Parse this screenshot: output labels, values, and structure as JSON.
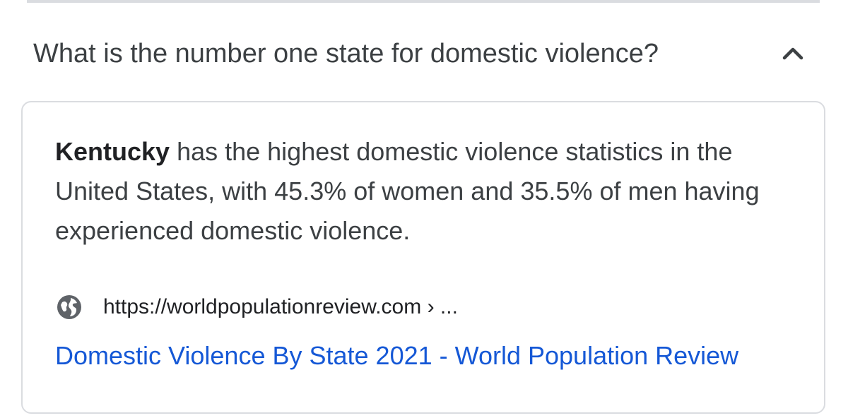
{
  "question": {
    "text": "What is the number one state for domestic violence?",
    "toggle_icon": "chevron-up-icon"
  },
  "answer": {
    "highlight": "Kentucky",
    "body": " has the highest domestic violence statistics in the United States, with 45.3% of women and 35.5% of men having experienced domestic violence."
  },
  "source": {
    "icon": "globe-icon",
    "url": "https://worldpopulationreview.com › ..."
  },
  "result": {
    "title": "Domestic Violence By State 2021 - World Population Review"
  },
  "colors": {
    "text": "#3c4043",
    "link": "#1558d6",
    "border": "#dadce0"
  }
}
